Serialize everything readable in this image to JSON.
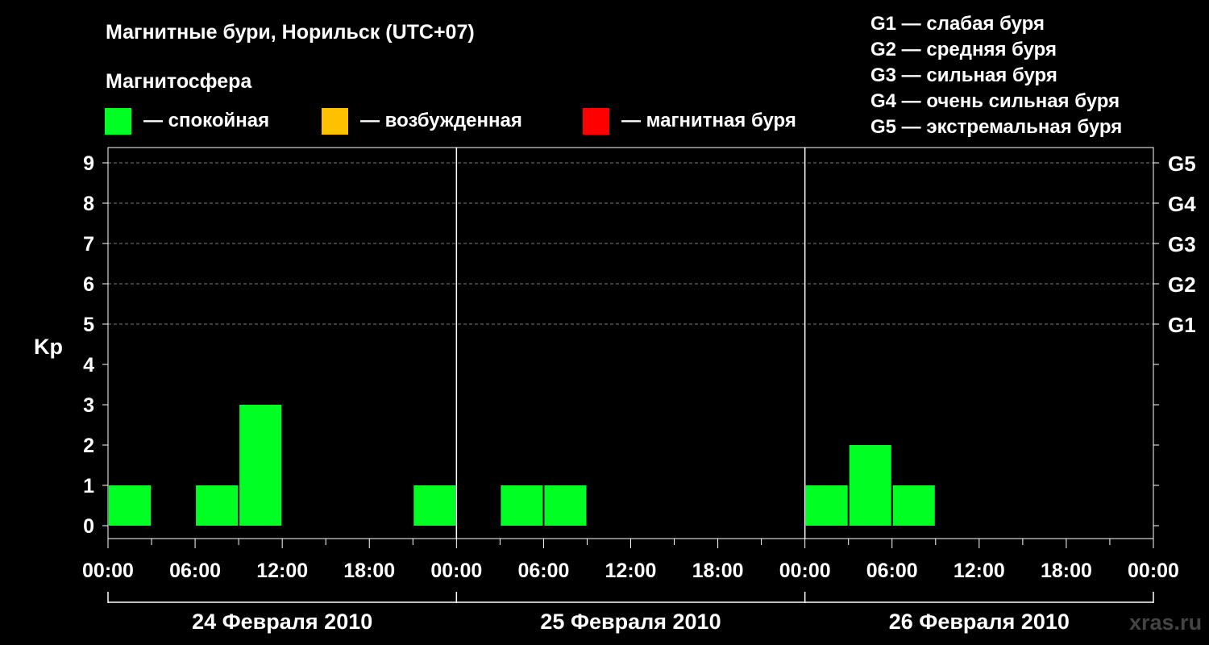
{
  "chart_data": {
    "type": "bar",
    "title": "Магнитные бури, Норильск (UTC+07)",
    "ylabel": "Kp",
    "ylim": [
      0,
      9
    ],
    "yticks": [
      "0",
      "1",
      "2",
      "3",
      "4",
      "5",
      "6",
      "7",
      "8",
      "9"
    ],
    "storm_levels": [
      {
        "kp": 5,
        "label": "G1"
      },
      {
        "kp": 6,
        "label": "G2"
      },
      {
        "kp": 7,
        "label": "G3"
      },
      {
        "kp": 8,
        "label": "G4"
      },
      {
        "kp": 9,
        "label": "G5"
      }
    ],
    "x_tick_labels": [
      "00:00",
      "06:00",
      "12:00",
      "18:00",
      "00:00",
      "06:00",
      "12:00",
      "18:00",
      "00:00",
      "06:00",
      "12:00",
      "18:00",
      "00:00"
    ],
    "days": [
      "24 Февраля 2010",
      "25 Февраля 2010",
      "26 Февраля 2010"
    ],
    "grid": "dashed at Kp 5-9",
    "interval_hours": 3,
    "intervals": [
      "24.02 00:00-03:00",
      "24.02 03:00-06:00",
      "24.02 06:00-09:00",
      "24.02 09:00-12:00",
      "24.02 12:00-15:00",
      "24.02 15:00-18:00",
      "24.02 18:00-21:00",
      "24.02 21:00-24:00",
      "25.02 00:00-03:00",
      "25.02 03:00-06:00",
      "25.02 06:00-09:00",
      "25.02 09:00-12:00",
      "25.02 12:00-15:00",
      "25.02 15:00-18:00",
      "25.02 18:00-21:00",
      "25.02 21:00-24:00",
      "26.02 00:00-03:00",
      "26.02 03:00-06:00",
      "26.02 06:00-09:00",
      "26.02 09:00-12:00",
      "26.02 12:00-15:00",
      "26.02 15:00-18:00",
      "26.02 18:00-21:00",
      "26.02 21:00-24:00"
    ],
    "values": [
      1,
      0,
      1,
      3,
      0,
      0,
      0,
      1,
      0,
      1,
      1,
      0,
      0,
      0,
      0,
      0,
      1,
      2,
      1,
      0,
      0,
      0,
      0,
      0
    ],
    "bar_color": "#00ff22"
  },
  "legend": {
    "heading": "Магнитосфера",
    "items": [
      {
        "label": "— спокойная",
        "color": "#00ff22"
      },
      {
        "label": "— возбужденная",
        "color": "#ffc000"
      },
      {
        "label": "— магнитная буря",
        "color": "#ff0000"
      }
    ]
  },
  "storm_legend": [
    "G1 — слабая буря",
    "G2 — средняя буря",
    "G3 — сильная буря",
    "G4 — очень сильная буря",
    "G5 — экстремальная буря"
  ],
  "watermark": "xras.ru"
}
